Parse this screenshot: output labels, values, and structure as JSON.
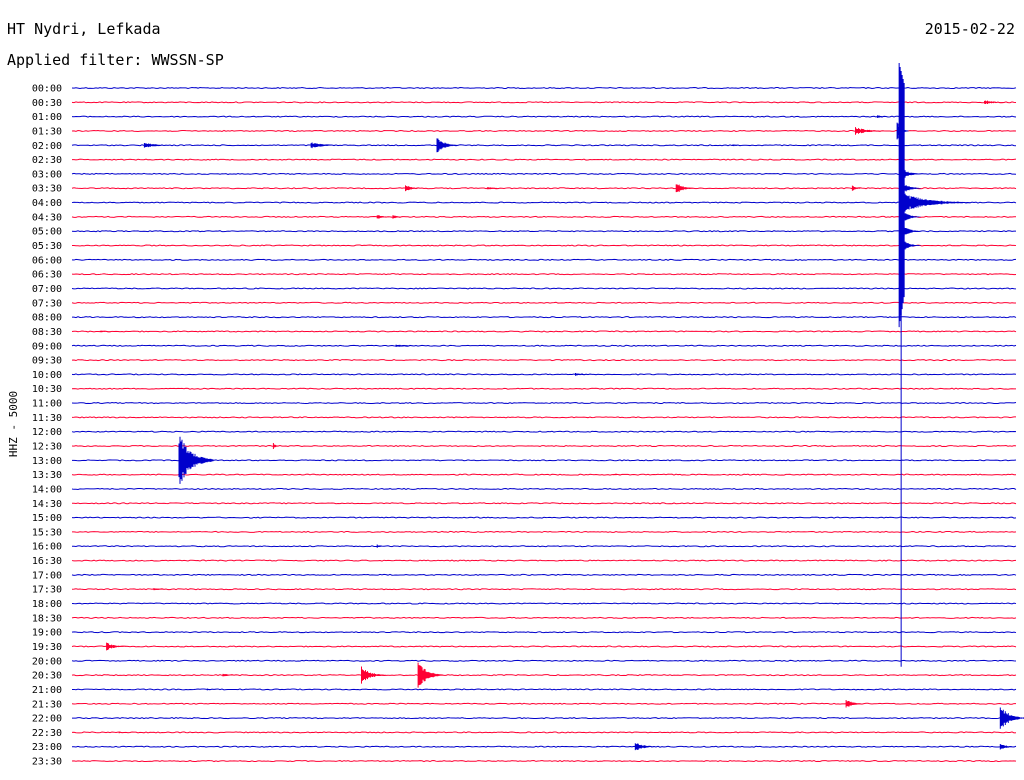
{
  "header": {
    "station": "HT Nydri, Lefkada",
    "filter": "Applied filter: WWSSN-SP",
    "date": "2015-02-22"
  },
  "chart_data": {
    "type": "line",
    "chart_kind": "helicorder",
    "title": "HT Nydri, Lefkada",
    "subtitle": "Applied filter: WWSSN-SP",
    "date": "2015-02-22",
    "ylabel": "HHZ - 5000",
    "xlabel": "",
    "row_minutes": 30,
    "x_range_minutes": [
      0,
      30
    ],
    "grid": false,
    "legend": "none",
    "colors": {
      "even_rows": "#0000cc",
      "odd_rows": "#ff0033"
    },
    "rows": [
      {
        "time": "00:00",
        "color": "blue"
      },
      {
        "time": "00:30",
        "color": "red"
      },
      {
        "time": "01:00",
        "color": "blue"
      },
      {
        "time": "01:30",
        "color": "red"
      },
      {
        "time": "02:00",
        "color": "blue"
      },
      {
        "time": "02:30",
        "color": "red"
      },
      {
        "time": "03:00",
        "color": "blue"
      },
      {
        "time": "03:30",
        "color": "red"
      },
      {
        "time": "04:00",
        "color": "blue"
      },
      {
        "time": "04:30",
        "color": "red"
      },
      {
        "time": "05:00",
        "color": "blue"
      },
      {
        "time": "05:30",
        "color": "red"
      },
      {
        "time": "06:00",
        "color": "blue"
      },
      {
        "time": "06:30",
        "color": "red"
      },
      {
        "time": "07:00",
        "color": "blue"
      },
      {
        "time": "07:30",
        "color": "red"
      },
      {
        "time": "08:00",
        "color": "blue"
      },
      {
        "time": "08:30",
        "color": "red"
      },
      {
        "time": "09:00",
        "color": "blue"
      },
      {
        "time": "09:30",
        "color": "red"
      },
      {
        "time": "10:00",
        "color": "blue"
      },
      {
        "time": "10:30",
        "color": "red"
      },
      {
        "time": "11:00",
        "color": "blue"
      },
      {
        "time": "11:30",
        "color": "red"
      },
      {
        "time": "12:00",
        "color": "blue"
      },
      {
        "time": "12:30",
        "color": "red"
      },
      {
        "time": "13:00",
        "color": "blue"
      },
      {
        "time": "13:30",
        "color": "red"
      },
      {
        "time": "14:00",
        "color": "blue"
      },
      {
        "time": "14:30",
        "color": "red"
      },
      {
        "time": "15:00",
        "color": "blue"
      },
      {
        "time": "15:30",
        "color": "red"
      },
      {
        "time": "16:00",
        "color": "blue"
      },
      {
        "time": "16:30",
        "color": "red"
      },
      {
        "time": "17:00",
        "color": "blue"
      },
      {
        "time": "17:30",
        "color": "red"
      },
      {
        "time": "18:00",
        "color": "blue"
      },
      {
        "time": "18:30",
        "color": "red"
      },
      {
        "time": "19:00",
        "color": "blue"
      },
      {
        "time": "19:30",
        "color": "red"
      },
      {
        "time": "20:00",
        "color": "blue"
      },
      {
        "time": "20:30",
        "color": "red"
      },
      {
        "time": "21:00",
        "color": "blue"
      },
      {
        "time": "21:30",
        "color": "red"
      },
      {
        "time": "22:00",
        "color": "blue"
      },
      {
        "time": "22:30",
        "color": "red"
      },
      {
        "time": "23:00",
        "color": "blue"
      },
      {
        "time": "23:30",
        "color": "red"
      }
    ],
    "events": [
      {
        "row": "00:30",
        "minute": 29.0,
        "amp": 0.35,
        "dur": 0.8
      },
      {
        "row": "01:00",
        "minute": 25.6,
        "amp": 0.25,
        "dur": 0.4
      },
      {
        "row": "01:30",
        "minute": 24.9,
        "amp": 0.55,
        "dur": 1.1
      },
      {
        "row": "02:00",
        "minute": 2.3,
        "amp": 0.45,
        "dur": 1.0
      },
      {
        "row": "02:00",
        "minute": 7.6,
        "amp": 0.45,
        "dur": 1.1
      },
      {
        "row": "02:00",
        "minute": 11.6,
        "amp": 1.2,
        "dur": 0.7
      },
      {
        "row": "02:00",
        "minute": 21.0,
        "amp": 0.15,
        "dur": 0.5
      },
      {
        "row": "03:30",
        "minute": 10.6,
        "amp": 0.5,
        "dur": 0.6
      },
      {
        "row": "03:30",
        "minute": 13.2,
        "amp": 0.25,
        "dur": 0.6
      },
      {
        "row": "03:30",
        "minute": 19.2,
        "amp": 0.9,
        "dur": 0.6
      },
      {
        "row": "03:30",
        "minute": 24.8,
        "amp": 0.4,
        "dur": 0.4
      },
      {
        "row": "04:30",
        "minute": 9.7,
        "amp": 0.35,
        "dur": 0.5
      },
      {
        "row": "04:30",
        "minute": 10.2,
        "amp": 0.3,
        "dur": 0.4
      },
      {
        "row": "08:30",
        "minute": 0.9,
        "amp": 0.15,
        "dur": 0.6
      },
      {
        "row": "09:00",
        "minute": 10.3,
        "amp": 0.2,
        "dur": 1.2
      },
      {
        "row": "10:00",
        "minute": 16.0,
        "amp": 0.2,
        "dur": 0.8
      },
      {
        "row": "12:30",
        "minute": 6.4,
        "amp": 0.5,
        "dur": 0.2
      },
      {
        "row": "13:00",
        "minute": 3.4,
        "amp": 4.0,
        "dur": 1.1
      },
      {
        "row": "13:30",
        "minute": 17.2,
        "amp": 0.12,
        "dur": 0.8
      },
      {
        "row": "16:00",
        "minute": 9.7,
        "amp": 0.25,
        "dur": 0.3
      },
      {
        "row": "17:30",
        "minute": 2.6,
        "amp": 0.15,
        "dur": 1.0
      },
      {
        "row": "19:30",
        "minute": 1.1,
        "amp": 0.6,
        "dur": 0.7
      },
      {
        "row": "20:30",
        "minute": 4.8,
        "amp": 0.25,
        "dur": 0.6
      },
      {
        "row": "20:30",
        "minute": 9.2,
        "amp": 1.3,
        "dur": 0.8
      },
      {
        "row": "20:30",
        "minute": 11.0,
        "amp": 2.2,
        "dur": 0.8
      },
      {
        "row": "21:00",
        "minute": 4.3,
        "amp": 0.15,
        "dur": 0.4
      },
      {
        "row": "21:30",
        "minute": 24.6,
        "amp": 0.7,
        "dur": 0.6
      },
      {
        "row": "22:00",
        "minute": 29.5,
        "amp": 2.0,
        "dur": 0.8
      },
      {
        "row": "22:30",
        "minute": 1.5,
        "amp": 0.15,
        "dur": 0.3
      },
      {
        "row": "23:00",
        "minute": 17.9,
        "amp": 0.75,
        "dur": 0.7
      },
      {
        "row": "23:00",
        "minute": 29.5,
        "amp": 0.6,
        "dur": 0.5
      },
      {
        "row": "23:00",
        "minute": 17.0,
        "amp": 0.15,
        "dur": 0.2
      }
    ],
    "main_event": {
      "row": "01:30",
      "minute": 26.35,
      "spans_until_row": "20:00",
      "coda_rows": [
        "03:00",
        "03:30",
        "04:00",
        "04:30",
        "05:00",
        "05:30"
      ]
    }
  }
}
